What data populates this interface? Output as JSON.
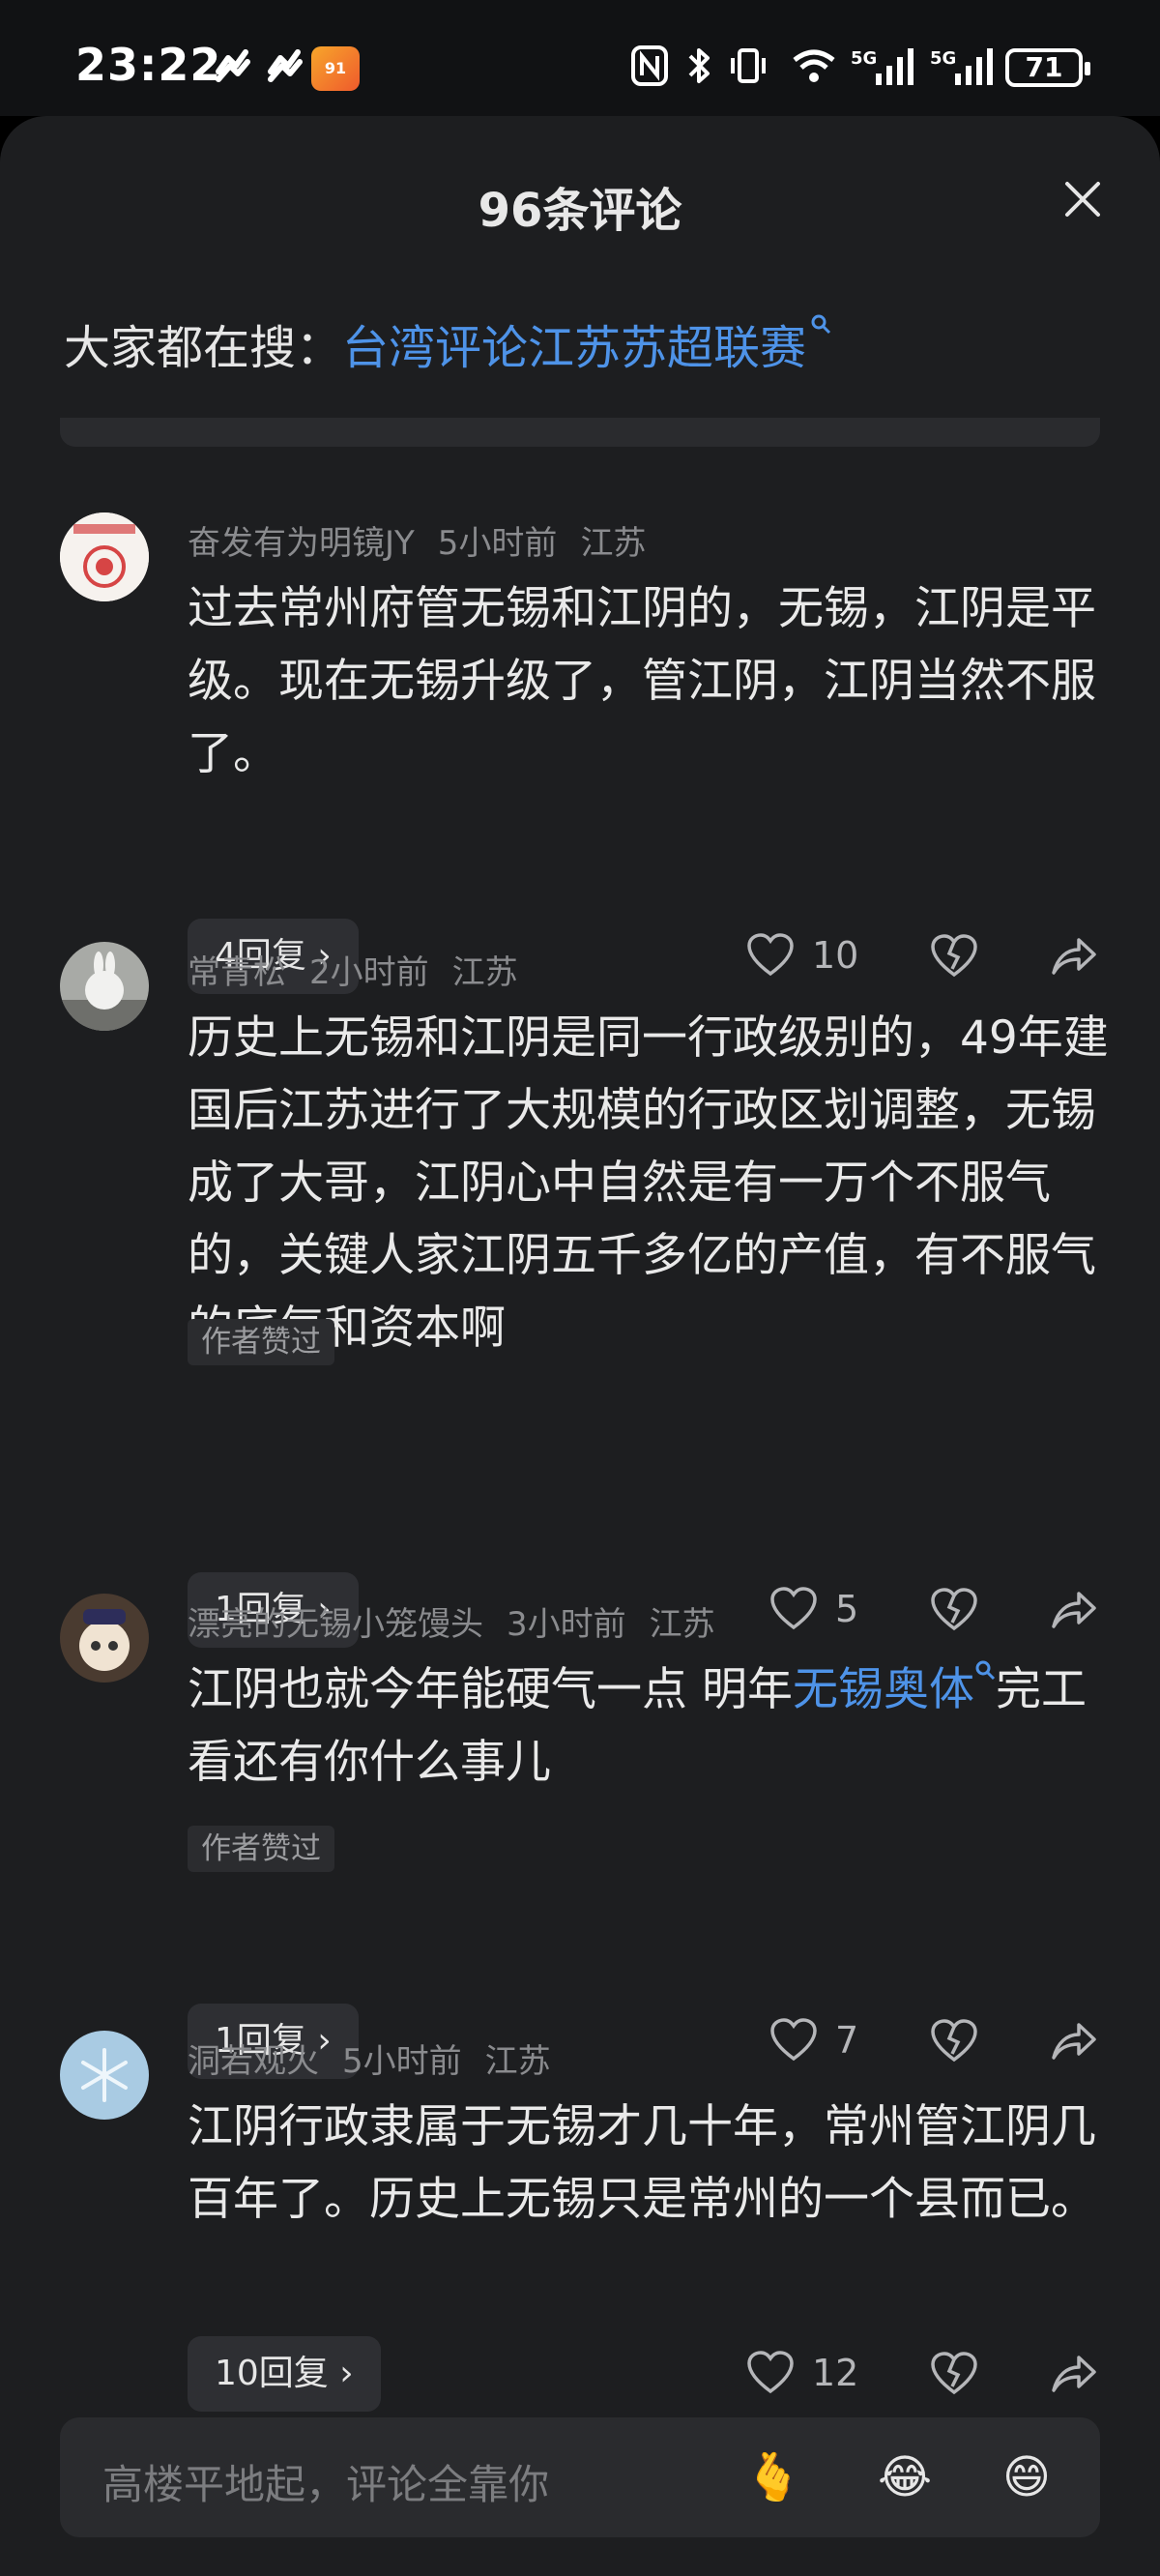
{
  "status_bar": {
    "time": "23:22",
    "battery": "71",
    "network_1": "5G",
    "network_2": "5G",
    "app_icon_text": "91"
  },
  "sheet": {
    "title": "96条评论",
    "hot_search_prefix": "大家都在搜：",
    "hot_search_link": "台湾评论江苏苏超联赛"
  },
  "comments": [
    {
      "user": "奋发有为明镜JY",
      "time": "5小时前",
      "location": "江苏",
      "text": "过去常州府管无锡和江阴的，无锡，江阴是平级。现在无锡升级了，管江阴，江阴当然不服了。",
      "author_liked": "",
      "replies": "4回复",
      "likes": "10"
    },
    {
      "user": "常青松",
      "time": "2小时前",
      "location": "江苏",
      "text": "历史上无锡和江阴是同一行政级别的，49年建国后江苏进行了大规模的行政区划调整，无锡成了大哥，江阴心中自然是有一万个不服气的，关键人家江阴五千多亿的产值，有不服气的底气和资本啊",
      "author_liked": "作者赞过",
      "replies": "1回复",
      "likes": "5"
    },
    {
      "user": "漂亮的无锡小笼馒头",
      "time": "3小时前",
      "location": "江苏",
      "text_before_link": "江阴也就今年能硬气一点 明年",
      "text_link": "无锡奥体",
      "text_after_link": "完工 看还有你什么事儿",
      "author_liked": "作者赞过",
      "replies": "1回复",
      "likes": "7"
    },
    {
      "user": "洞若观火",
      "time": "5小时前",
      "location": "江苏",
      "text": "江阴行政隶属于无锡才几十年，常州管江阴几百年了。历史上无锡只是常州的一个县而已。",
      "author_liked": "",
      "replies": "10回复",
      "likes": "12"
    }
  ],
  "input": {
    "placeholder": "高楼平地起，评论全靠你",
    "emojis": [
      "🫰",
      "😂",
      "😄"
    ]
  },
  "colors": {
    "background": "#1d1e20",
    "link": "#4e93e8",
    "meta": "#8a8b8e"
  },
  "icons": [
    "heart-icon",
    "broken-heart-icon",
    "share-icon",
    "close-icon",
    "search-icon"
  ]
}
